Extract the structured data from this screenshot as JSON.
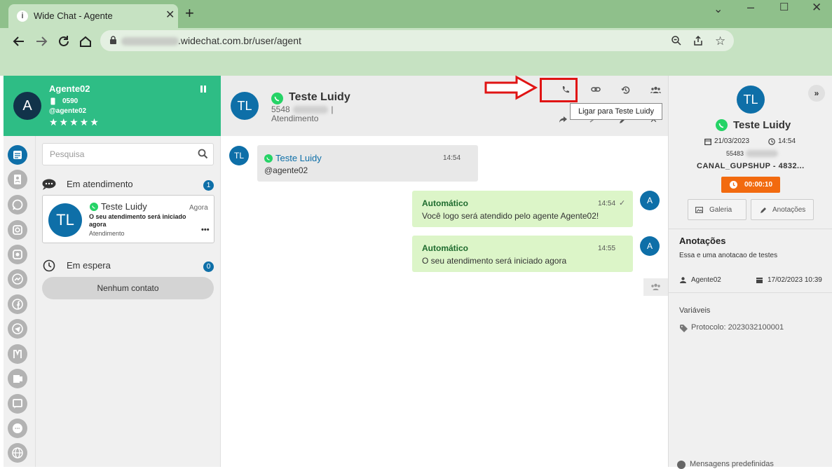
{
  "browser": {
    "tab_title": "Wide Chat - Agente",
    "tab_favicon": "i",
    "url_domain": ".widechat.com.br/user/agent",
    "window_controls": [
      "minimize",
      "maximize",
      "close"
    ]
  },
  "agent": {
    "avatar_letter": "A",
    "name": "Agente02",
    "extension": "0590",
    "username": "@agente02",
    "stars": "★★★★★"
  },
  "sidebar_rail": {
    "icons": [
      "chat-list-icon",
      "contacts-icon",
      "whatsapp-icon",
      "instagram-icon",
      "instagram-alt-icon",
      "messenger-icon",
      "facebook-icon",
      "telegram-icon",
      "omnichannel-icon",
      "teams-icon",
      "webchat-icon",
      "sms-icon",
      "globe-icon"
    ]
  },
  "list": {
    "search_placeholder": "Pesquisa",
    "in_service": {
      "label": "Em atendimento",
      "count": "1"
    },
    "conversation": {
      "initials": "TL",
      "name": "Teste Luidy",
      "time": "Agora",
      "last_message": "O seu atendimento será iniciado agora",
      "status": "Atendimento",
      "more": "•••"
    },
    "waiting": {
      "label": "Em espera",
      "count": "0",
      "empty": "Nenhum contato"
    }
  },
  "chat": {
    "contact_initials": "TL",
    "contact_name": "Teste Luidy",
    "phone_prefix": "5548",
    "phone_suffix": "|",
    "status": "Atendimento",
    "tooltip": "Ligar para Teste Luidy",
    "messages": [
      {
        "direction": "in",
        "avatar": "TL",
        "sender": "Teste Luidy",
        "text": "@agente02",
        "time": "14:54"
      },
      {
        "direction": "out",
        "avatar": "A",
        "sender": "Automático",
        "text": "Você logo será atendido pelo agente Agente02!",
        "time": "14:54",
        "check": "✓"
      },
      {
        "direction": "out",
        "avatar": "A",
        "sender": "Automático",
        "text": "O seu atendimento será iniciado agora",
        "time": "14:55"
      }
    ]
  },
  "details": {
    "initials": "TL",
    "collapse": "»",
    "name": "Teste Luidy",
    "date": "21/03/2023",
    "time": "14:54",
    "phone_prefix": "55483",
    "channel": "CANAL_GUPSHUP - 4832...",
    "timer": "00:00:10",
    "gallery_label": "Galeria",
    "notes_label": "Anotações",
    "annotations": {
      "title": "Anotações",
      "text": "Essa e uma anotacao de testes",
      "user": "Agente02",
      "date": "17/02/2023 10:39"
    },
    "variables": {
      "title": "Variáveis",
      "protocol": "Protocolo: 2023032100001"
    },
    "predefined": "Mensagens predefinidas"
  },
  "colors": {
    "accent_green": "#2ebd85",
    "primary_blue": "#0e6fa8",
    "timer_orange": "#f26a0f",
    "highlight_red": "#e01414"
  }
}
